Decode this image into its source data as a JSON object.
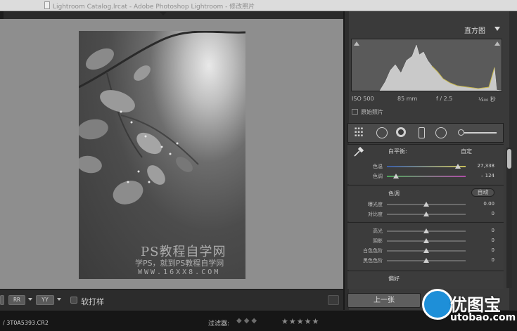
{
  "window": {
    "title": "Lightroom Catalog.lrcat - Adobe Photoshop Lightroom - 修改照片"
  },
  "photo": {
    "watermark_line1": "PS教程自学网",
    "watermark_line2": "学PS，就到PS教程自学网",
    "watermark_line3": "WWW.16XX8.COM"
  },
  "toolbar": {
    "view_btn_1": "RR",
    "view_btn_2": "YY",
    "soft_proof_label": "软打样"
  },
  "histogram": {
    "title": "直方图",
    "iso": "ISO 500",
    "focal": "85 mm",
    "aperture": "f / 2.5",
    "shutter": "¹⁄₄₀₀ 秒",
    "original_photo_label": "原始照片"
  },
  "basic": {
    "white_balance_label": "白平衡:",
    "white_balance_value": "自定",
    "temp": {
      "label": "色温",
      "value": "27,338",
      "position": 0.9
    },
    "tint": {
      "label": "色调",
      "value": "– 124",
      "position": 0.12
    },
    "tone_title": "色调",
    "auto_label": "自动",
    "tone_rows": [
      {
        "label": "曝光度",
        "value": "0.00",
        "position": 0.5
      },
      {
        "label": "对比度",
        "value": "0",
        "position": 0.5
      }
    ],
    "presence_rows": [
      {
        "label": "高光",
        "value": "0",
        "position": 0.5
      },
      {
        "label": "阴影",
        "value": "0",
        "position": 0.5
      },
      {
        "label": "白色色阶",
        "value": "0",
        "position": 0.5
      },
      {
        "label": "黑色色阶",
        "value": "0",
        "position": 0.5
      }
    ],
    "presence_title": "偏好"
  },
  "nav": {
    "prev_label": "上一张"
  },
  "filmstrip": {
    "file_name": "/ 3T0A5393.CR2",
    "filter_label": "过滤器:",
    "stars": "★★★★★",
    "diamonds": "◆◆◆"
  },
  "logo": {
    "name": "优图宝",
    "url": "utobao.com"
  },
  "colors": {
    "panel": "#3a3a3a",
    "workspace": "#8e8e8e",
    "logo_blue": "#1e8fd8"
  }
}
